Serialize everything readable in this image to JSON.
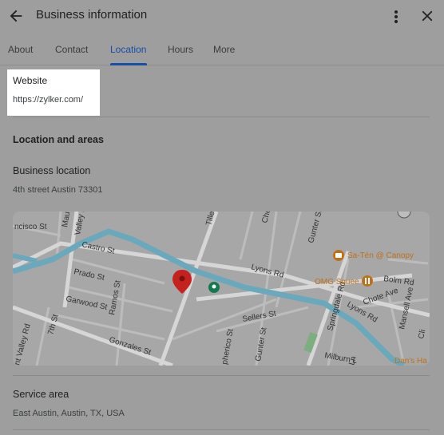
{
  "header": {
    "title": "Business information"
  },
  "tabs": [
    {
      "label": "About"
    },
    {
      "label": "Contact"
    },
    {
      "label": "Location"
    },
    {
      "label": "Hours"
    },
    {
      "label": "More"
    }
  ],
  "active_tab": "Location",
  "website": {
    "label": "Website",
    "url": "https://zylker.com/"
  },
  "location_section": {
    "heading": "Location and areas",
    "business_location_label": "Business location",
    "business_location_value": "4th street Austin 73301"
  },
  "map": {
    "streets": {
      "lcisco": "ncisco St",
      "maud": "Maud",
      "valley": "Valley Rd",
      "castro": "Castro St",
      "prado": "Prado St",
      "garwood": "Garwood St",
      "ramos": "Ramos St",
      "seventh": "7th St",
      "gonzales": "Gonzales St",
      "tillery": "Tille",
      "chef": "Che",
      "gunter_top": "Gunter St",
      "lyons1": "Lyons Rd",
      "lyons2": "Lyons Rd",
      "sellers": "Sellers St",
      "pherico": "pherico St",
      "gunter_bottom": "Gunter St",
      "springdale": "Springdale Rd",
      "bolm": "Bolm Rd",
      "chote": "Chote Ave",
      "mansell": "Mansell Ave",
      "milburn": "Milburn L",
      "valley2": "nt Valley Rd",
      "ln": "Ln",
      "cli": "Cli"
    },
    "places": {
      "saten": "Sa-Tén @ Canopy",
      "omg": "OMG Squee",
      "dans": "Dan's Ha"
    },
    "colors": {
      "river": "#6aa8bc",
      "pin": "#c5221f",
      "place": "#c0701a",
      "green_pin": "#137a4f"
    }
  },
  "service_area": {
    "label": "Service area",
    "value": "East Austin, Austin, TX, USA"
  }
}
